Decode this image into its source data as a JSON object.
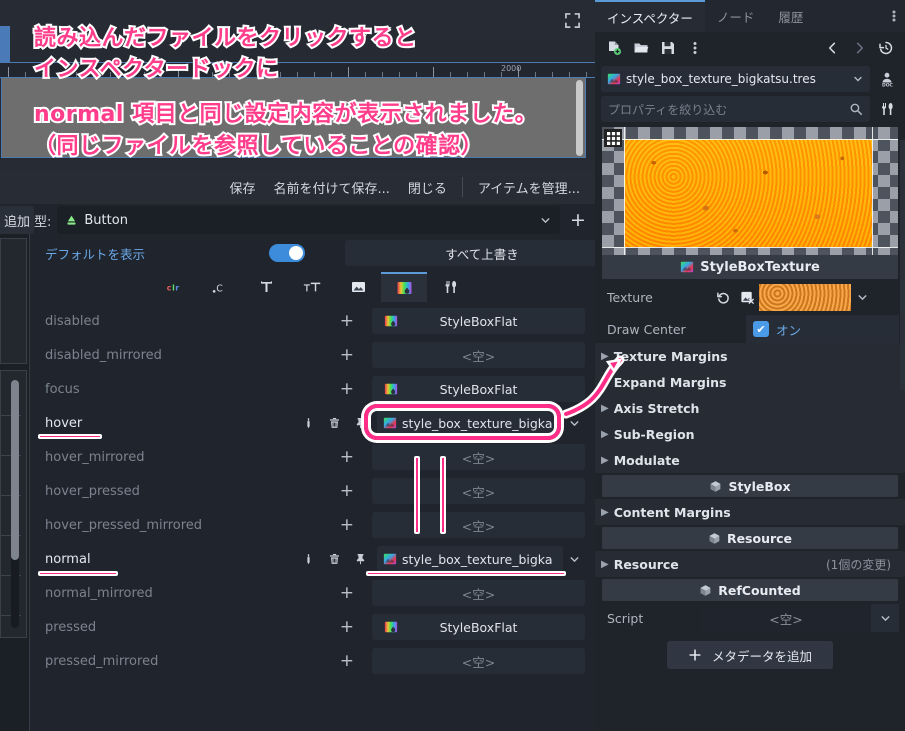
{
  "annotation": {
    "lines": [
      "読み込んだファイルをクリックすると",
      "インスペクタードックに",
      "normal 項目と同じ設定内容が表示されました。",
      "（同じファイルを参照していることの確認）"
    ],
    "color": "#ff3d8b",
    "outline_color": "#ffffff"
  },
  "viewport": {
    "expand_icon": "expand-icon",
    "ruler_label": "2000"
  },
  "theme_editor": {
    "toolbar": {
      "save": "保存",
      "save_as": "名前を付けて保存...",
      "close": "閉じる",
      "manage_items": "アイテムを管理..."
    },
    "add_button": "追加",
    "type_label": "型:",
    "type_value": "Button",
    "type_icon": "button-node-icon",
    "add_type_icon": "plus-icon",
    "show_defaults_label": "デフォルトを表示",
    "show_defaults_on": true,
    "override_all": "すべて上書き",
    "categories": [
      {
        "name": "color-category-icon",
        "label": "clr",
        "active": false
      },
      {
        "name": "constant-category-icon",
        "label": ".C",
        "active": false
      },
      {
        "name": "font-category-icon",
        "label": "T",
        "active": false
      },
      {
        "name": "font-size-category-icon",
        "label": "TT",
        "active": false
      },
      {
        "name": "icon-category-icon",
        "label": "image",
        "active": false
      },
      {
        "name": "stylebox-category-icon",
        "label": "stylebox",
        "active": true
      },
      {
        "name": "misc-category-icon",
        "label": "tools",
        "active": false
      }
    ],
    "empty_value": "<空>",
    "rows": [
      {
        "name": "disabled",
        "value": "StyleBoxFlat",
        "kind": "stylebox",
        "overridden": false
      },
      {
        "name": "disabled_mirrored",
        "value": "<空>",
        "kind": "empty",
        "overridden": false
      },
      {
        "name": "focus",
        "value": "StyleBoxFlat",
        "kind": "stylebox",
        "overridden": false
      },
      {
        "name": "hover",
        "value": "style_box_texture_bigka",
        "kind": "resource",
        "overridden": true
      },
      {
        "name": "hover_mirrored",
        "value": "<空>",
        "kind": "empty",
        "overridden": false
      },
      {
        "name": "hover_pressed",
        "value": "<空>",
        "kind": "empty",
        "overridden": false
      },
      {
        "name": "hover_pressed_mirrored",
        "value": "<空>",
        "kind": "empty",
        "overridden": false
      },
      {
        "name": "normal",
        "value": "style_box_texture_bigka",
        "kind": "resource",
        "overridden": true
      },
      {
        "name": "normal_mirrored",
        "value": "<空>",
        "kind": "empty",
        "overridden": false
      },
      {
        "name": "pressed",
        "value": "StyleBoxFlat",
        "kind": "stylebox",
        "overridden": false
      },
      {
        "name": "pressed_mirrored",
        "value": "<空>",
        "kind": "empty",
        "overridden": false
      }
    ],
    "row_icons": {
      "edit": "edit-icon",
      "delete": "trash-icon",
      "pin": "pin-icon",
      "add": "plus-icon"
    }
  },
  "inspector": {
    "tabs": [
      {
        "label": "インスペクター",
        "active": true
      },
      {
        "label": "ノード",
        "active": false
      },
      {
        "label": "履歴",
        "active": false
      }
    ],
    "toolbar_icons": [
      "new-resource-icon",
      "open-resource-icon",
      "save-resource-icon",
      "more-options-icon",
      "history-back-icon",
      "history-forward-icon",
      "history-icon"
    ],
    "resource_path": "style_box_texture_bigkatsu.tres",
    "resource_icon": "stylebox-texture-icon",
    "doc_icon": "open-docs-icon",
    "filter_placeholder": "プロパティを絞り込む",
    "search_icon": "search-icon",
    "tools_icon": "object-tools-icon",
    "preview_title": "StyleBoxTexture",
    "preview_icon": "stylebox-texture-icon",
    "properties": {
      "texture_label": "Texture",
      "texture_revert_icon": "revert-icon",
      "texture_quickload_icon": "quick-load-icon",
      "draw_center_label": "Draw Center",
      "draw_center_value": "オン",
      "draw_center_checked": true,
      "groups": [
        "Texture Margins",
        "Expand Margins",
        "Axis Stretch",
        "Sub-Region",
        "Modulate"
      ],
      "stylebox_banner": "StyleBox",
      "content_margins": "Content Margins",
      "resource_banner": "Resource",
      "resource_group": "Resource",
      "resource_changes": "(1個の変更)",
      "refcounted_banner": "RefCounted",
      "script_label": "Script",
      "script_value": "<空>",
      "add_metadata": "メタデータを追加",
      "class_icon": "class-cube-icon"
    }
  }
}
